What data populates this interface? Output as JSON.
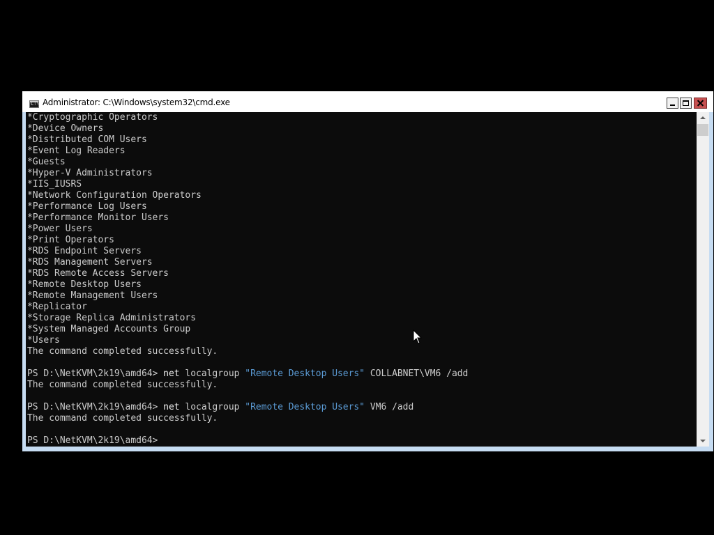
{
  "window": {
    "title": "Administrator: C:\\Windows\\system32\\cmd.exe",
    "icon": "cmd-icon",
    "icon_glyph": "C:\\"
  },
  "colors": {
    "console_bg": "#0c0c0c",
    "console_text": "#cccccc",
    "string_text": "#5b9bd5",
    "command_text": "#f0f0f0"
  },
  "console": {
    "lines": [
      [
        {
          "t": "*Cryptographic Operators",
          "c": ""
        }
      ],
      [
        {
          "t": "*Device Owners",
          "c": ""
        }
      ],
      [
        {
          "t": "*Distributed COM Users",
          "c": ""
        }
      ],
      [
        {
          "t": "*Event Log Readers",
          "c": ""
        }
      ],
      [
        {
          "t": "*Guests",
          "c": ""
        }
      ],
      [
        {
          "t": "*Hyper-V Administrators",
          "c": ""
        }
      ],
      [
        {
          "t": "*IIS_IUSRS",
          "c": ""
        }
      ],
      [
        {
          "t": "*Network Configuration Operators",
          "c": ""
        }
      ],
      [
        {
          "t": "*Performance Log Users",
          "c": ""
        }
      ],
      [
        {
          "t": "*Performance Monitor Users",
          "c": ""
        }
      ],
      [
        {
          "t": "*Power Users",
          "c": ""
        }
      ],
      [
        {
          "t": "*Print Operators",
          "c": ""
        }
      ],
      [
        {
          "t": "*RDS Endpoint Servers",
          "c": ""
        }
      ],
      [
        {
          "t": "*RDS Management Servers",
          "c": ""
        }
      ],
      [
        {
          "t": "*RDS Remote Access Servers",
          "c": ""
        }
      ],
      [
        {
          "t": "*Remote Desktop Users",
          "c": ""
        }
      ],
      [
        {
          "t": "*Remote Management Users",
          "c": ""
        }
      ],
      [
        {
          "t": "*Replicator",
          "c": ""
        }
      ],
      [
        {
          "t": "*Storage Replica Administrators",
          "c": ""
        }
      ],
      [
        {
          "t": "*System Managed Accounts Group",
          "c": ""
        }
      ],
      [
        {
          "t": "*Users",
          "c": ""
        }
      ],
      [
        {
          "t": "The command completed successfully.",
          "c": ""
        }
      ],
      [
        {
          "t": "",
          "c": ""
        }
      ],
      [
        {
          "t": "PS D:\\NetKVM\\2k19\\amd64> ",
          "c": ""
        },
        {
          "t": "net",
          "c": "kw"
        },
        {
          "t": " localgroup ",
          "c": ""
        },
        {
          "t": "\"Remote Desktop Users\"",
          "c": "str"
        },
        {
          "t": " COLLABNET\\VM6 /add",
          "c": ""
        }
      ],
      [
        {
          "t": "The command completed successfully.",
          "c": ""
        }
      ],
      [
        {
          "t": "",
          "c": ""
        }
      ],
      [
        {
          "t": "PS D:\\NetKVM\\2k19\\amd64> ",
          "c": ""
        },
        {
          "t": "net",
          "c": "kw"
        },
        {
          "t": " localgroup ",
          "c": ""
        },
        {
          "t": "\"Remote Desktop Users\"",
          "c": "str"
        },
        {
          "t": " VM6 /add",
          "c": ""
        }
      ],
      [
        {
          "t": "The command completed successfully.",
          "c": ""
        }
      ],
      [
        {
          "t": "",
          "c": ""
        }
      ],
      [
        {
          "t": "PS D:\\NetKVM\\2k19\\amd64>",
          "c": ""
        }
      ]
    ]
  }
}
